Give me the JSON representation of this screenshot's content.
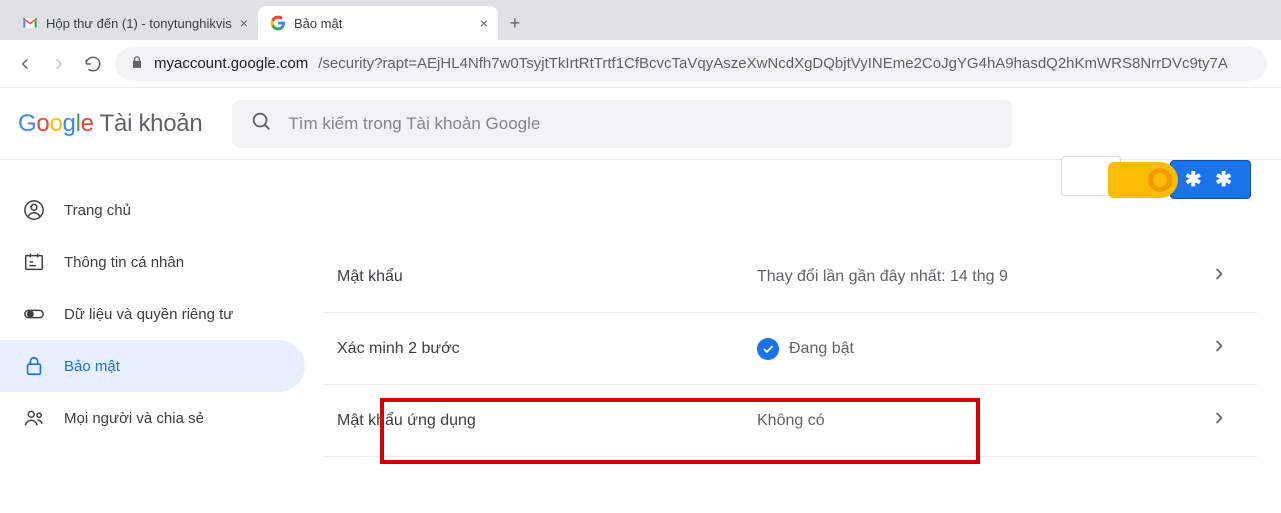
{
  "browser": {
    "tabs": [
      {
        "title": "Hộp thư đến (1) - tonytunghikvis",
        "active": false
      },
      {
        "title": "Bảo mật",
        "active": true
      }
    ],
    "url_host": "myaccount.google.com",
    "url_path": "/security?rapt=AEjHL4Nfh7w0TsyjtTkIrtRtTrtf1CfBcvcTaVqyAszeXwNcdXgDQbjtVyINEme2CoJgYG4hA9hasdQ2hKmWRS8NrrDVc9ty7A"
  },
  "header": {
    "product": "Tài khoản",
    "search_placeholder": "Tìm kiếm trong Tài khoản Google"
  },
  "sidebar": {
    "items": [
      {
        "label": "Trang chủ"
      },
      {
        "label": "Thông tin cá nhân"
      },
      {
        "label": "Dữ liệu và quyền riêng tư"
      },
      {
        "label": "Bảo mật"
      },
      {
        "label": "Mọi người và chia sẻ"
      }
    ]
  },
  "illustration": {
    "pwd_mask": "✱ ✱"
  },
  "rows": [
    {
      "label": "Mật khẩu",
      "value": "Thay đổi lần gần đây nhất: 14 thg 9",
      "check": false
    },
    {
      "label": "Xác minh 2 bước",
      "value": "Đang bật",
      "check": true
    },
    {
      "label": "Mật khẩu ứng dụng",
      "value": "Không có",
      "check": false
    }
  ]
}
